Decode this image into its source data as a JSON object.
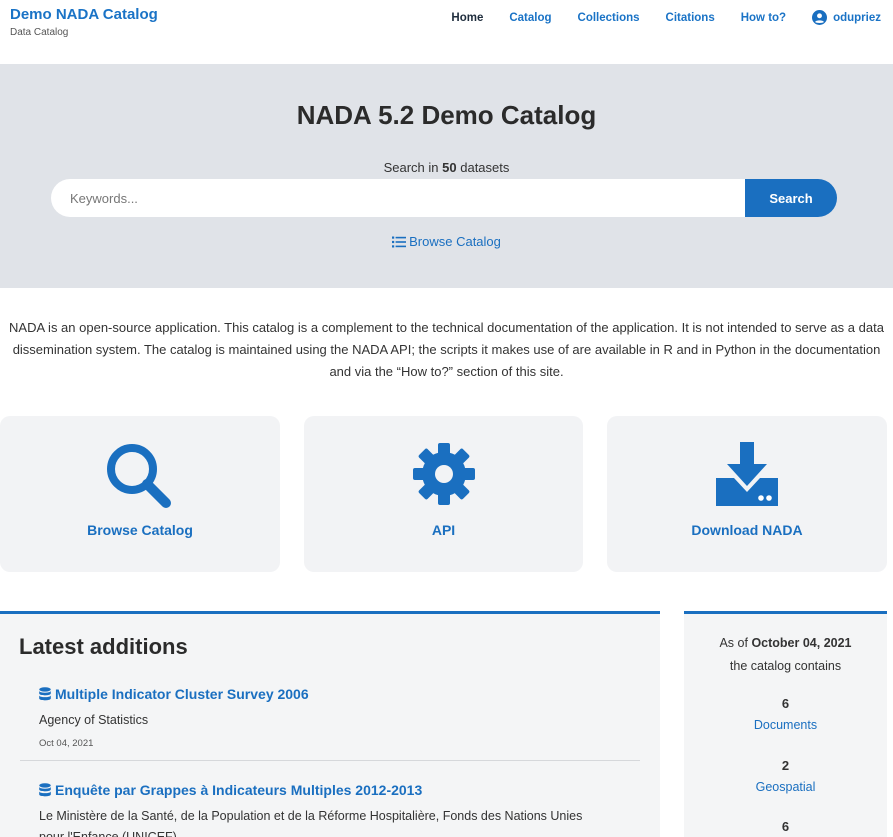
{
  "brand": {
    "title": "Demo NADA Catalog",
    "subtitle": "Data Catalog"
  },
  "nav": {
    "home": "Home",
    "catalog": "Catalog",
    "collections": "Collections",
    "citations": "Citations",
    "howto": "How to?",
    "user": "odupriez"
  },
  "hero": {
    "title": "NADA 5.2 Demo Catalog",
    "count_prefix": "Search in",
    "count_value": "50",
    "count_suffix": "datasets",
    "search_placeholder": "Keywords...",
    "search_button": "Search",
    "browse_link": "Browse Catalog"
  },
  "intro": "NADA is an open-source application. This catalog is a complement to the technical documentation of the application. It is not intended to serve as a data dissemination system. The catalog is maintained using the NADA API; the scripts it makes use of are available in R and in Python in the documentation and via the “How to?” section of this site.",
  "cards": [
    {
      "label": "Browse Catalog",
      "icon": "search-icon"
    },
    {
      "label": "API",
      "icon": "gear-icon"
    },
    {
      "label": "Download NADA",
      "icon": "download-icon"
    }
  ],
  "latest": {
    "heading": "Latest additions",
    "items": [
      {
        "title": "Multiple Indicator Cluster Survey 2006",
        "agency": "Agency of Statistics",
        "date": "Oct 04, 2021"
      },
      {
        "title": "Enquête par Grappes à Indicateurs Multiples 2012-2013",
        "agency": "Le Ministère de la Santé, de la Population et de la Réforme Hospitalière, Fonds des Nations Unies pour l'Enfance (UNICEF)"
      }
    ]
  },
  "stats": {
    "asof_prefix": "As of",
    "asof_date": "October 04, 2021",
    "asof_suffix": "the catalog contains",
    "items": [
      {
        "count": "6",
        "label": "Documents"
      },
      {
        "count": "2",
        "label": "Geospatial"
      },
      {
        "count": "6"
      }
    ]
  },
  "colors": {
    "accent": "#1a6fc0",
    "hero_bg": "#e0e3e8",
    "card_bg": "#f2f3f5"
  }
}
